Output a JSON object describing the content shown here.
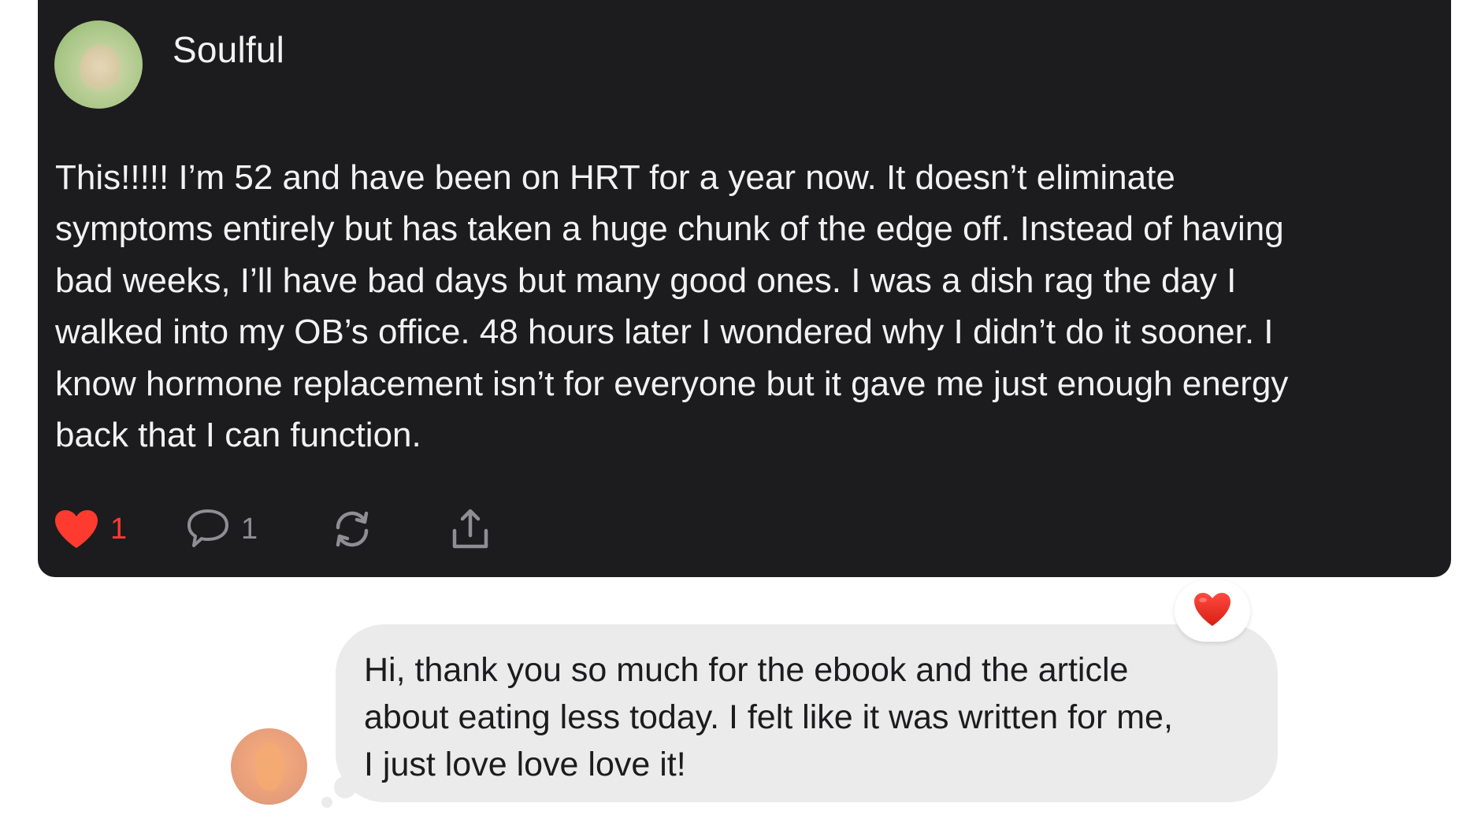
{
  "post": {
    "author": "Soulful",
    "avatar_icon": "profile-photo",
    "body": "This!!!!!  I’m 52 and have been on HRT for a year now.  It doesn’t eliminate\nsymptoms entirely but has taken a huge chunk of the edge off.  Instead of having\nbad weeks, I’ll have bad days but many good ones.  I was a dish rag the day I\nwalked into my OB’s office.  48 hours later I wondered why I didn’t do it sooner.  I\nknow hormone replacement isn’t for everyone but it gave me just enough energy\nback that I can function.",
    "actions": {
      "like": {
        "icon": "heart-icon",
        "count": "1",
        "color": "#ff3b30"
      },
      "reply": {
        "icon": "speech-bubble-icon",
        "count": "1"
      },
      "repost": {
        "icon": "repost-icon"
      },
      "share": {
        "icon": "share-icon"
      }
    },
    "card_color": "#1c1c1e"
  },
  "message": {
    "text": "Hi, thank you so much for the ebook and the article\nabout eating less today. I felt like it was written for me,\nI just love love love it!",
    "reaction": "heart-icon",
    "bubble_color": "#ebebeb"
  }
}
